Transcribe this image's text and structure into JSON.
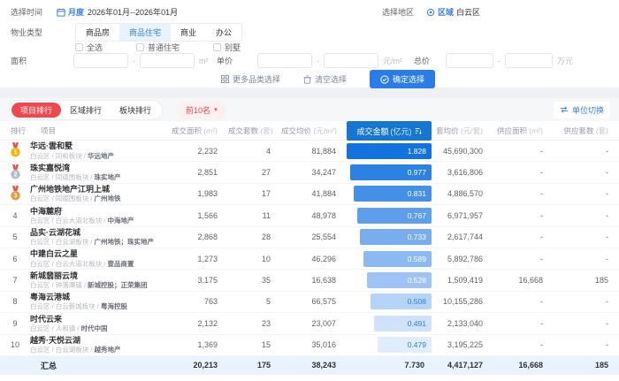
{
  "filters": {
    "time": {
      "label": "选择时间",
      "mode": "月度",
      "range": "2026年01月--2026年01月"
    },
    "region": {
      "label": "选择地区",
      "type": "区域",
      "value": "白云区"
    },
    "property_type": {
      "label": "物业类型",
      "tabs": [
        "商品房",
        "商品住宅",
        "商业",
        "办公"
      ],
      "active_tab": "商品住宅",
      "checkboxes": [
        "全选",
        "普通住宅",
        "别墅"
      ]
    },
    "area": {
      "label": "面积",
      "unit": "m²"
    },
    "unit_price": {
      "label": "单价",
      "unit": "元/m²"
    },
    "total_price": {
      "label": "总价",
      "unit": "万元"
    },
    "more_categories_label": "更多品类选择",
    "clear_label": "清空选择",
    "confirm_label": "确定选择"
  },
  "ranking": {
    "tabs": [
      "项目排行",
      "区域排行",
      "板块排行"
    ],
    "active_tab": "项目排行",
    "top_filter_label": "前10名",
    "unit_switch_label": "单位切换",
    "columns": [
      {
        "label": "排行",
        "unit": ""
      },
      {
        "label": "项目",
        "unit": ""
      },
      {
        "label": "成交面积",
        "unit": "(m²)"
      },
      {
        "label": "成交套数",
        "unit": "(套)"
      },
      {
        "label": "成交均价",
        "unit": "(元/m²)"
      },
      {
        "label": "成交金额",
        "unit": "(亿元)",
        "highlighted": true,
        "sorted": true
      },
      {
        "label": "套均价",
        "unit": "(元/套)"
      },
      {
        "label": "供应面积",
        "unit": "(m²)"
      },
      {
        "label": "供应套数",
        "unit": "(套)"
      }
    ],
    "rows": [
      {
        "rank": 1,
        "medal": "gold",
        "name": "华远·雲和墅",
        "area_path": "白云区 / 同和板块",
        "developer": "华远地产",
        "deal_area": "2,232",
        "deal_units": "4",
        "deal_avg_price": "81,884",
        "deal_amount": "1.828",
        "bar": {
          "width_pct": 100,
          "color": "#1373de",
          "text_color": "#ffffff"
        },
        "avg_per_unit": "45,690,300",
        "supply_area": "-",
        "supply_units": "-"
      },
      {
        "rank": 2,
        "medal": "silver",
        "name": "珠实嘉悦湾",
        "area_path": "白云区 / 同德围板块",
        "developer": "珠实地产",
        "deal_area": "2,851",
        "deal_units": "27",
        "deal_avg_price": "34,247",
        "deal_amount": "0.977",
        "bar": {
          "width_pct": 96,
          "color": "#2c82e2",
          "text_color": "#ffffff"
        },
        "avg_per_unit": "3,616,806",
        "supply_area": "-",
        "supply_units": "-"
      },
      {
        "rank": 3,
        "medal": "bronze",
        "name": "广州地铁地产江玥上城",
        "area_path": "白云区 / 同德围板块",
        "developer": "广州地铁",
        "deal_area": "1,983",
        "deal_units": "17",
        "deal_avg_price": "41,884",
        "deal_amount": "0.831",
        "bar": {
          "width_pct": 92,
          "color": "#4590e7",
          "text_color": "#ffffff"
        },
        "avg_per_unit": "4,886,570",
        "supply_area": "-",
        "supply_units": "-"
      },
      {
        "rank": 4,
        "medal": null,
        "name": "中海麓府",
        "area_path": "白云区 / 白云大道北板块",
        "developer": "中海地产",
        "deal_area": "1,566",
        "deal_units": "11",
        "deal_avg_price": "48,978",
        "deal_amount": "0.767",
        "bar": {
          "width_pct": 88,
          "color": "#5e9feb",
          "text_color": "#ffffff"
        },
        "avg_per_unit": "6,971,957",
        "supply_area": "-",
        "supply_units": "-"
      },
      {
        "rank": 5,
        "medal": null,
        "name": "品实·云湖花城",
        "area_path": "白云区 / 白云湖板块",
        "developer": "广州地铁；珠实地产",
        "deal_area": "2,868",
        "deal_units": "28",
        "deal_avg_price": "25,554",
        "deal_amount": "0.733",
        "bar": {
          "width_pct": 84,
          "color": "#78adf0",
          "text_color": "#ffffff"
        },
        "avg_per_unit": "2,617,744",
        "supply_area": "-",
        "supply_units": "-"
      },
      {
        "rank": 6,
        "medal": null,
        "name": "中建白云之星",
        "area_path": "白云区 / 白云大道北板块",
        "developer": "壹品商置",
        "deal_area": "1,273",
        "deal_units": "10",
        "deal_avg_price": "46,296",
        "deal_amount": "0.589",
        "bar": {
          "width_pct": 80,
          "color": "#8bb9f2",
          "text_color": "#ffffff"
        },
        "avg_per_unit": "5,892,786",
        "supply_area": "-",
        "supply_units": "-"
      },
      {
        "rank": 7,
        "medal": null,
        "name": "新城翡丽云境",
        "area_path": "白云区 / 钟落潭镇",
        "developer": "新城控股；正荣集团",
        "deal_area": "3,175",
        "deal_units": "35",
        "deal_avg_price": "16,638",
        "deal_amount": "0.528",
        "bar": {
          "width_pct": 76,
          "color": "#9dc4f4",
          "text_color": "#ffffff"
        },
        "avg_per_unit": "1,509,419",
        "supply_area": "16,668",
        "supply_units": "185"
      },
      {
        "rank": 8,
        "medal": null,
        "name": "粤海云港城",
        "area_path": "白云区 / 白云新城板块",
        "developer": "粤海控股",
        "deal_area": "763",
        "deal_units": "5",
        "deal_avg_price": "66,575",
        "deal_amount": "0.508",
        "bar": {
          "width_pct": 72,
          "color": "#b6d4f7",
          "text_color": "#2f7fd7"
        },
        "avg_per_unit": "10,155,286",
        "supply_area": "-",
        "supply_units": "-"
      },
      {
        "rank": 9,
        "medal": null,
        "name": "时代云来",
        "area_path": "白云区 / 人和镇",
        "developer": "时代中国",
        "deal_area": "2,132",
        "deal_units": "23",
        "deal_avg_price": "23,007",
        "deal_amount": "0.491",
        "bar": {
          "width_pct": 68,
          "color": "#cfe2fa",
          "text_color": "#2f7fd7"
        },
        "avg_per_unit": "2,133,040",
        "supply_area": "-",
        "supply_units": "-"
      },
      {
        "rank": 10,
        "medal": null,
        "name": "越秀·天悦云湖",
        "area_path": "白云区 / 白云湖板块",
        "developer": "越秀地产",
        "deal_area": "1,369",
        "deal_units": "15",
        "deal_avg_price": "35,016",
        "deal_amount": "0.479",
        "bar": {
          "width_pct": 64,
          "color": "#e0edfc",
          "text_color": "#2f7fd7"
        },
        "avg_per_unit": "3,195,225",
        "supply_area": "-",
        "supply_units": "-"
      }
    ],
    "summary": {
      "label": "汇总",
      "deal_area": "20,213",
      "deal_units": "175",
      "deal_avg_price": "38,243",
      "deal_amount": "7.730",
      "avg_per_unit": "4,417,127",
      "supply_area": "16,668",
      "supply_units": "185"
    }
  },
  "colors": {
    "primary_blue": "#2a7ce8",
    "link_blue": "#3a7fe8",
    "header_highlight_blue": "#1677d2",
    "accent_red": "#f0484e",
    "summary_bg": "#e8f3fd",
    "medal_gold": "#f7b500",
    "medal_silver": "#aebdcc",
    "medal_bronze": "#e29b3d",
    "ribbon_red": "#ef4f4f"
  }
}
